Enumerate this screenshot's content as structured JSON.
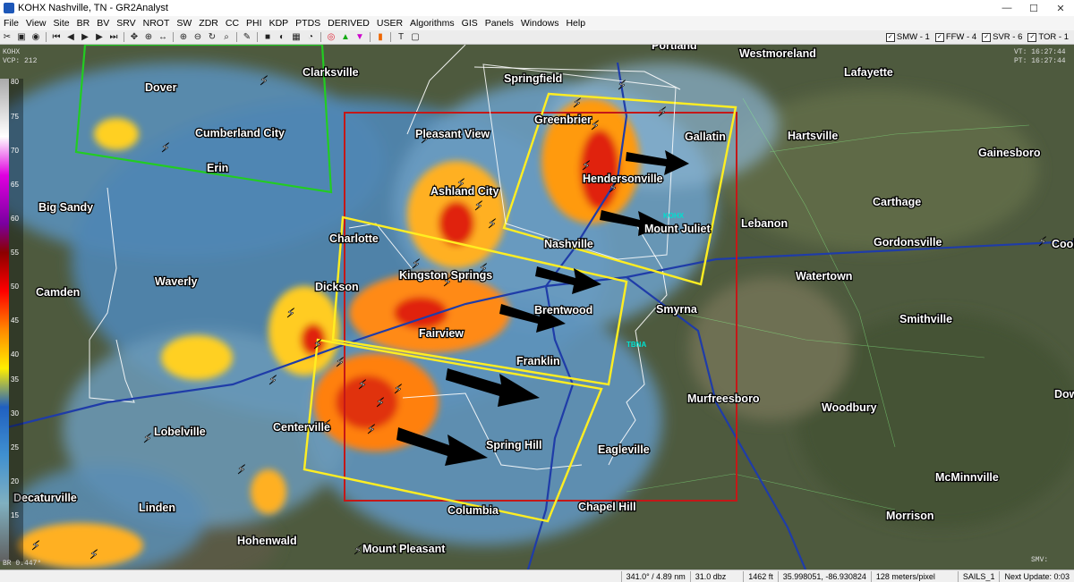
{
  "window": {
    "title": "KOHX Nashville, TN - GR2Analyst",
    "min": "—",
    "max": "☐",
    "close": "✕"
  },
  "menu": [
    "File",
    "View",
    "Site",
    "BR",
    "BV",
    "SRV",
    "NROT",
    "SW",
    "ZDR",
    "CC",
    "PHI",
    "KDP",
    "PTDS",
    "DERIVED",
    "USER",
    "Algorithms",
    "GIS",
    "Panels",
    "Windows",
    "Help"
  ],
  "warnings": [
    {
      "label": "SMW - 1",
      "checked": "✓"
    },
    {
      "label": "FFW - 4",
      "checked": "✓"
    },
    {
      "label": "SVR - 6",
      "checked": "✓"
    },
    {
      "label": "TOR - 1",
      "checked": "✓"
    }
  ],
  "overlay": {
    "site": "KOHX",
    "vcp": "VCP: 212",
    "vt": "VT: 16:27:44",
    "pt": "PT: 16:27:44",
    "smv": "SMV:",
    "radar_badge": "KOHX",
    "tdwr_badge": "TBNA",
    "tilt": "BR 0.447°"
  },
  "scale": {
    "ticks": [
      "80",
      "75",
      "70",
      "65",
      "60",
      "55",
      "50",
      "45",
      "40",
      "35",
      "30",
      "25",
      "20",
      "15"
    ]
  },
  "cities": [
    {
      "name": "Portland"
    },
    {
      "name": "Westmoreland"
    },
    {
      "name": "Lafayette"
    },
    {
      "name": "Clarksville"
    },
    {
      "name": "Springfield"
    },
    {
      "name": "Dover"
    },
    {
      "name": "Cumberland City"
    },
    {
      "name": "Greenbrier"
    },
    {
      "name": "Gallatin"
    },
    {
      "name": "Hartsville"
    },
    {
      "name": "Gainesboro"
    },
    {
      "name": "Pleasant View"
    },
    {
      "name": "Erin"
    },
    {
      "name": "Ashland City"
    },
    {
      "name": "Hendersonville"
    },
    {
      "name": "Carthage"
    },
    {
      "name": "Big Sandy"
    },
    {
      "name": "Lebanon"
    },
    {
      "name": "Mount Juliet"
    },
    {
      "name": "Charlotte"
    },
    {
      "name": "Nashville"
    },
    {
      "name": "Gordonsville"
    },
    {
      "name": "Cookeville"
    },
    {
      "name": "Kingston Springs"
    },
    {
      "name": "Watertown"
    },
    {
      "name": "Camden"
    },
    {
      "name": "Waverly"
    },
    {
      "name": "Dickson"
    },
    {
      "name": "Brentwood"
    },
    {
      "name": "Smyrna"
    },
    {
      "name": "Smithville"
    },
    {
      "name": "Fairview"
    },
    {
      "name": "Franklin"
    },
    {
      "name": "Murfreesboro"
    },
    {
      "name": "Woodbury"
    },
    {
      "name": "Dowelltown"
    },
    {
      "name": "Centerville"
    },
    {
      "name": "Lobelville"
    },
    {
      "name": "Spring Hill"
    },
    {
      "name": "Eagleville"
    },
    {
      "name": "McMinnville"
    },
    {
      "name": "Decaturville"
    },
    {
      "name": "Linden"
    },
    {
      "name": "Columbia"
    },
    {
      "name": "Chapel Hill"
    },
    {
      "name": "Morrison"
    },
    {
      "name": "Hohenwald"
    },
    {
      "name": "Mount Pleasant"
    }
  ],
  "status": {
    "azimuth": "341.0° / 4.89 nm",
    "value": "31.0 dbz",
    "height": "1462 ft",
    "coords": "35.998051, -86.930824",
    "resolution": "128 meters/pixel",
    "scan": "SAILS_1",
    "next": "Next Update: 0:03"
  },
  "colors": {
    "warning_yellow": "#ffee22",
    "warning_red": "#c41818",
    "flood_green": "#22cc22"
  }
}
